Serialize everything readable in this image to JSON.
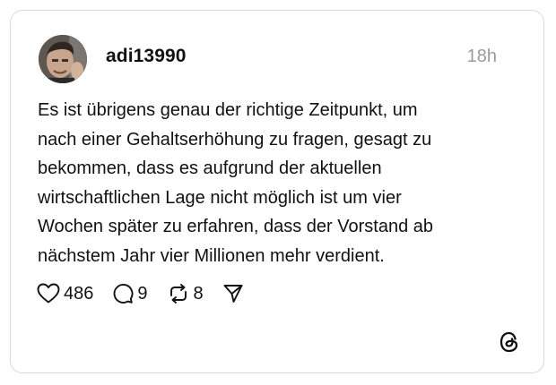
{
  "post": {
    "username": "adi13990",
    "timestamp": "18h",
    "text": "Es ist übrigens genau der richtige Zeitpunkt, um\nnach einer Gehaltserhöhung zu fragen, gesagt zu\nbekommen, dass es aufgrund der aktuellen\nwirtschaftlichen Lage nicht möglich ist um vier\nWochen später zu erfahren, dass der Vorstand ab\nnächstem Jahr vier Millionen mehr verdient."
  },
  "actions": {
    "like": {
      "icon": "heart-icon",
      "count": "486"
    },
    "reply": {
      "icon": "comment-icon",
      "count": "9"
    },
    "repost": {
      "icon": "repost-icon",
      "count": "8"
    },
    "share": {
      "icon": "send-icon"
    }
  },
  "brand": {
    "logo_icon": "threads-logo-icon"
  },
  "colors": {
    "text": "#111111",
    "muted": "#9a9a9a",
    "border": "#d9d9d9",
    "background": "#ffffff"
  }
}
